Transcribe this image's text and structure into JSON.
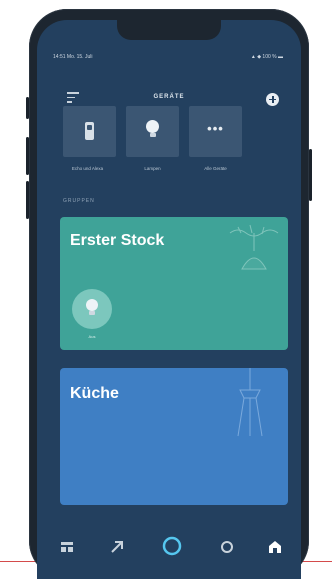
{
  "status_bar": {
    "time": "14:51  Mo. 15. Juli",
    "right": "▲ ◆ 100 % ▬"
  },
  "header": {
    "title": "GERÄTE"
  },
  "device_tiles": [
    {
      "label": "Echo und Alexa",
      "icon": "switch-icon"
    },
    {
      "label": "Lampen",
      "icon": "bulb-icon"
    },
    {
      "label": "Alle Geräte",
      "icon": "more-icon"
    }
  ],
  "groups_label": "GRUPPEN",
  "groups": [
    {
      "name": "Erster Stock",
      "color": "#3fa398",
      "light_label": "Aus"
    },
    {
      "name": "Küche",
      "color": "#3f7fc4"
    }
  ],
  "bottom_nav": [
    "home-icon",
    "activity-icon",
    "alexa-icon",
    "gear-icon",
    "devices-icon"
  ],
  "colors": {
    "screen_bg": "#23405f",
    "tile_bg": "#3b5673",
    "accent": "#56c7ef"
  }
}
